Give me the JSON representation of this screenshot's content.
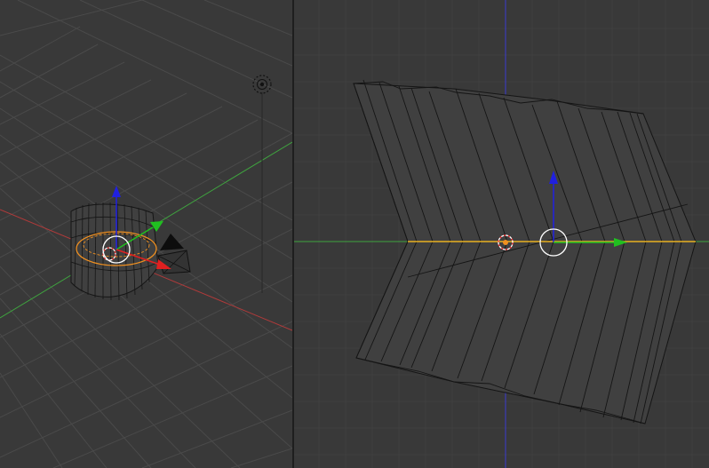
{
  "viewports": {
    "left": {
      "view": "perspective"
    },
    "right": {
      "view": "orthographic"
    }
  },
  "colors": {
    "background": "#393939",
    "grid": "#4a4a4a",
    "x_axis": "#b03a3a",
    "y_axis": "#3fa33f",
    "z_axis": "#3a3ad0",
    "selection_outline": "#f09020",
    "wire": "#151515",
    "mesh_face": "#404040",
    "gizmo_x": "#e02020",
    "gizmo_y": "#20c020",
    "gizmo_z": "#2020e0"
  },
  "icons": [
    "lamp-icon",
    "camera-icon",
    "3d-cursor-icon",
    "transform-gizmo-icon"
  ]
}
